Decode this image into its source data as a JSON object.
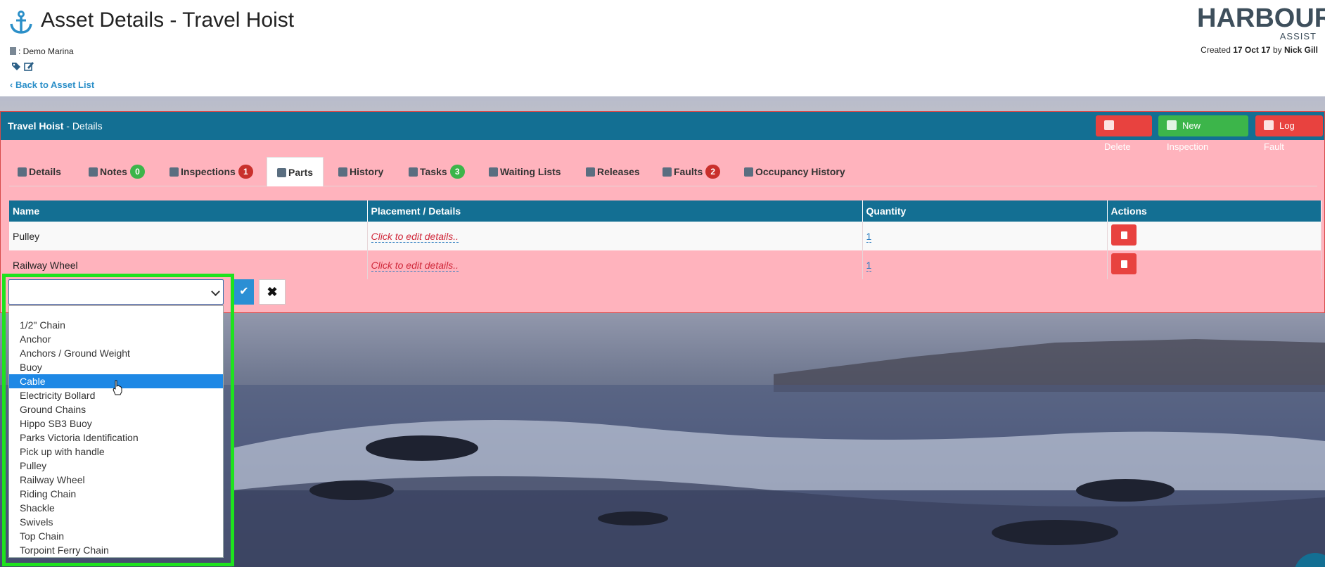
{
  "header": {
    "title": "Asset Details - Travel Hoist",
    "marina_label": ": Demo Marina",
    "back_link": "Back to Asset List",
    "logo_brand": "HARBOUR",
    "logo_sub": "ASSIST",
    "created_prefix": "Created",
    "created_date": "17 Oct 17",
    "created_by_word": "by",
    "created_by": "Nick Gill"
  },
  "panel": {
    "asset_name": "Travel Hoist",
    "section": "- Details",
    "buttons": {
      "delete": "Delete",
      "new_inspection": "New Inspection",
      "log_fault": "Log Fault"
    }
  },
  "tabs": [
    {
      "label": "Details",
      "icon": "anchor-icon"
    },
    {
      "label": "Notes",
      "icon": "file-icon",
      "badge": "0"
    },
    {
      "label": "Inspections",
      "icon": "clock-icon",
      "badge": "1"
    },
    {
      "label": "Parts",
      "icon": "puzzle-icon",
      "active": true
    },
    {
      "label": "History",
      "icon": "history-icon"
    },
    {
      "label": "Tasks",
      "icon": "tasks-icon",
      "badge": "3"
    },
    {
      "label": "Waiting Lists",
      "icon": "clock-icon"
    },
    {
      "label": "Releases",
      "icon": "sign-out-icon"
    },
    {
      "label": "Faults",
      "icon": "ambulance-icon",
      "badge": "2"
    },
    {
      "label": "Occupancy History",
      "icon": "bed-icon"
    }
  ],
  "table": {
    "headers": [
      "Name",
      "Placement / Details",
      "Quantity",
      "Actions"
    ],
    "rows": [
      {
        "name": "Pulley",
        "details": "Click to edit details..",
        "quantity": "1"
      },
      {
        "name": "Railway Wheel",
        "details": "Click to edit details..",
        "quantity": "1"
      }
    ]
  },
  "add_row": {
    "select_value": "",
    "confirm_icon": "check-icon",
    "cancel_icon": "close-icon",
    "cancel_glyph": "✖",
    "confirm_glyph": "✔"
  },
  "dropdown": {
    "selected": "Cable",
    "options": [
      "1/2\" Chain",
      "Anchor",
      "Anchors / Ground Weight",
      "Buoy",
      "Cable",
      "Electricity Bollard",
      "Ground Chains",
      "Hippo SB3 Buoy",
      "Parks Victoria Identification",
      "Pick up with handle",
      "Pulley",
      "Railway Wheel",
      "Riding Chain",
      "Shackle",
      "Swivels",
      "Top Chain",
      "Torpoint Ferry Chain"
    ]
  },
  "colors": {
    "panel_header": "#136f93",
    "panel_bg": "#ffb3bd",
    "danger": "#e8423f",
    "success": "#3cb54a",
    "link": "#2b8fc8",
    "highlight_outline": "#1ee31e"
  }
}
